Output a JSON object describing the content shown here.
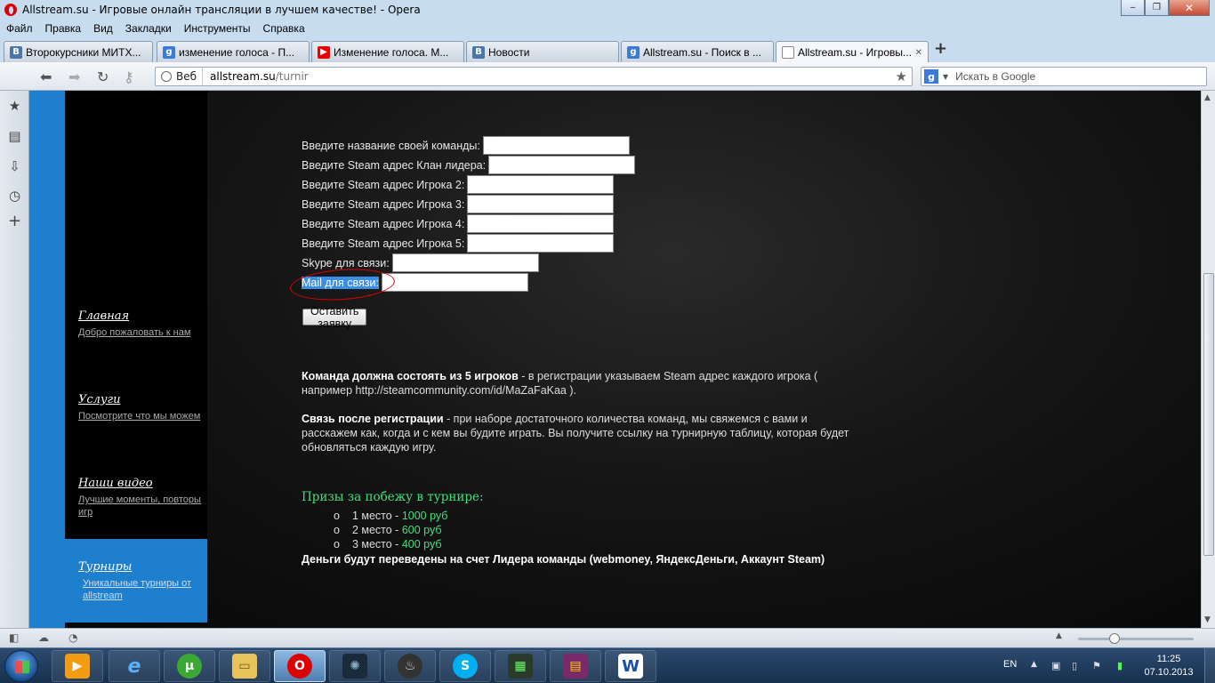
{
  "window": {
    "title": "Allstream.su - Игровые онлайн трансляции в лучшем качестве! - Opera",
    "minimize": "‒",
    "maximize": "❐",
    "close": "✕"
  },
  "menu": [
    "Файл",
    "Правка",
    "Вид",
    "Закладки",
    "Инструменты",
    "Справка"
  ],
  "tabs": [
    {
      "title": "Второкурсники МИТХ...",
      "icon": "vk",
      "letter": "B"
    },
    {
      "title": "изменение голоса - П...",
      "icon": "google",
      "letter": "g"
    },
    {
      "title": "Изменение голоса. М...",
      "icon": "youtube",
      "letter": "▶"
    },
    {
      "title": "Новости",
      "icon": "vk",
      "letter": "B"
    },
    {
      "title": "Allstream.su - Поиск в ...",
      "icon": "google",
      "letter": "g"
    },
    {
      "title": "Allstream.su - Игровы...",
      "icon": "document",
      "letter": "",
      "active": true
    }
  ],
  "navbar": {
    "web_label": "Веб",
    "url_host": "allstream.su",
    "url_path": "/turnir",
    "search_placeholder": "Искать в Google"
  },
  "sidebar": {
    "items": [
      {
        "title": "Главная",
        "subtitle": "Добро пожаловать к нам"
      },
      {
        "title": "Услуги",
        "subtitle": "Посмотрите что мы можем"
      },
      {
        "title": "Наши видео",
        "subtitle": "Лучшие моменты, повторы игр"
      },
      {
        "title": "Турниры",
        "subtitle": "Уникальные турниры от allstream",
        "active": true
      }
    ]
  },
  "form": {
    "fields": [
      {
        "label": "Введите название своей команды:",
        "value": ""
      },
      {
        "label": "Введите Steam адрес Клан лидера:",
        "value": ""
      },
      {
        "label": "Введите Steam адрес Игрока 2:",
        "value": ""
      },
      {
        "label": "Введите Steam адрес Игрока 3:",
        "value": ""
      },
      {
        "label": "Введите Steam адрес Игрока 4:",
        "value": ""
      },
      {
        "label": "Введите Steam адрес Игрока 5:",
        "value": ""
      },
      {
        "label": "Skype для связи:",
        "value": ""
      },
      {
        "label": "Mail для связи:",
        "value": "",
        "selected": true
      }
    ],
    "submit_label": "Оставить заявку"
  },
  "info": {
    "p1_bold": "Команда должна состоять из 5 игроков",
    "p1_rest": " - в регистрации указываем Steam адрес каждого игрока ( например http://steamcommunity.com/id/MaZaFaKaa ).",
    "p2_bold": "Связь после регистрации",
    "p2_rest": " - при наборе достаточного количества команд, мы свяжемся с вами и расскажем как, когда и с кем вы будите играть. Вы получите ссылку на турнирную таблицу, которая будет обновляться каждую игру."
  },
  "prizes": {
    "title": "Призы за побежу в турнире:",
    "items": [
      {
        "place": "1 место - ",
        "amount": "1000 руб"
      },
      {
        "place": "2 место - ",
        "amount": "600 руб"
      },
      {
        "place": "3 место - ",
        "amount": "400 руб"
      }
    ],
    "footer": "Деньги будут переведены на счет Лидера команды (webmoney, ЯндексДеньги, Аккаунт Steam)"
  },
  "taskbar": {
    "lang": "EN",
    "time": "11:25",
    "date": "07.10.2013"
  },
  "colors": {
    "accent_blue": "#1f7fcf",
    "prize_green": "#3fe07a",
    "selection_blue": "#3a8ee6"
  }
}
